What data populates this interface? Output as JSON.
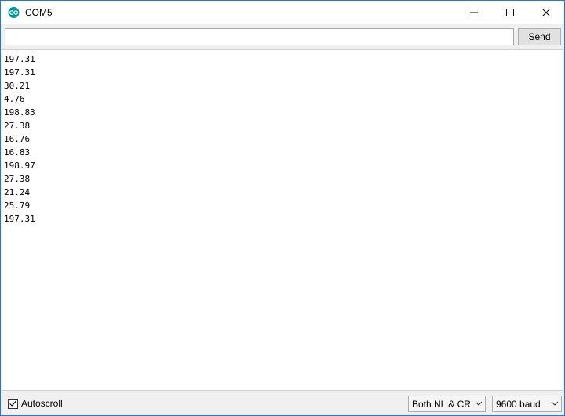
{
  "window": {
    "title": "COM5",
    "icon": "arduino-infinity-icon",
    "accent_color": "#1b7ad6",
    "controls": [
      "minimize-icon",
      "maximize-icon",
      "close-icon"
    ]
  },
  "toolbar": {
    "input_value": "",
    "send_label": "Send"
  },
  "output": {
    "lines": [
      "197.31",
      "197.31",
      "30.21",
      "4.76",
      "198.83",
      "27.38",
      "16.76",
      "16.83",
      "198.97",
      "27.38",
      "21.24",
      "25.79",
      "197.31"
    ]
  },
  "statusbar": {
    "autoscroll_label": "Autoscroll",
    "autoscroll_checked": true,
    "line_ending": "Both NL & CR",
    "baud_rate": "9600 baud"
  }
}
